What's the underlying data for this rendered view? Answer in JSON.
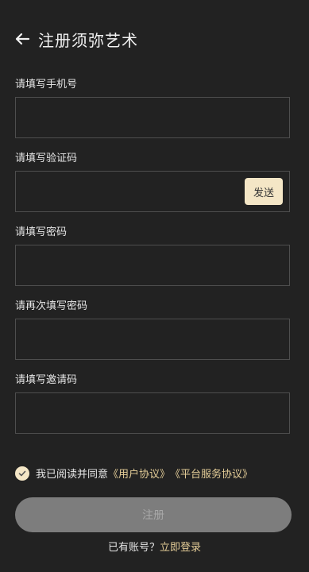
{
  "header": {
    "title": "注册须弥艺术",
    "back_icon": "arrow-left-icon"
  },
  "fields": [
    {
      "label": "请填写手机号",
      "value": "",
      "placeholder": ""
    },
    {
      "label": "请填写验证码",
      "value": "",
      "placeholder": "",
      "send_label": "发送"
    },
    {
      "label": "请填写密码",
      "value": "",
      "placeholder": ""
    },
    {
      "label": "请再次填写密码",
      "value": "",
      "placeholder": ""
    },
    {
      "label": "请填写邀请码",
      "value": "",
      "placeholder": ""
    }
  ],
  "agreement": {
    "prefix": "我已阅读并同意",
    "user_agreement": "《用户协议》",
    "platform_agreement": "《平台服务协议》",
    "checked": true,
    "check_icon": "check-circle-icon"
  },
  "register_label": "注册",
  "footer": {
    "question": "已有账号？",
    "login_link": "立即登录"
  },
  "colors": {
    "background": "#222222",
    "accent": "#f4e6c6",
    "link": "#e3cc97",
    "button_disabled": "#7d7d7d"
  }
}
